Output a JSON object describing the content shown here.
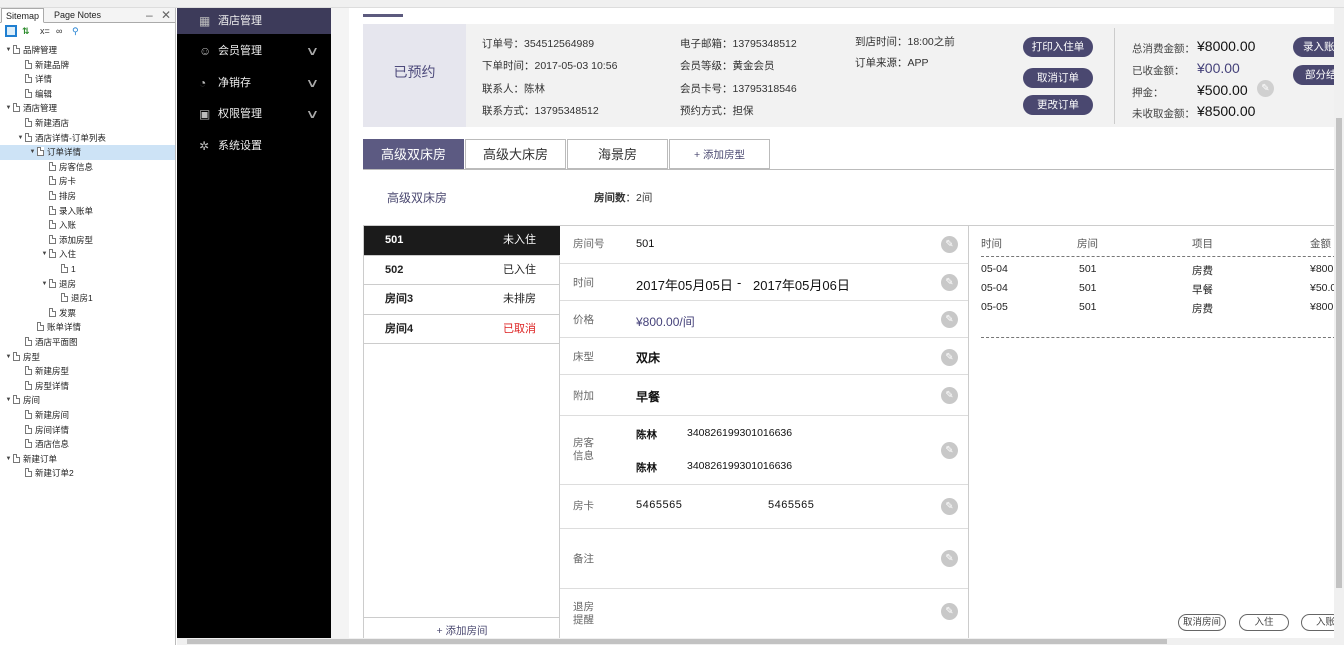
{
  "sitemap": {
    "tabs": [
      "Sitemap",
      "Page Notes"
    ],
    "tools": {
      "add_folder": "",
      "x_eq": "x=",
      "link": "∞"
    },
    "tree": [
      {
        "label": "品牌管理",
        "level": 0,
        "toggle": "▼"
      },
      {
        "label": "新建品牌",
        "level": 1,
        "toggle": ""
      },
      {
        "label": "详情",
        "level": 1,
        "toggle": ""
      },
      {
        "label": "编辑",
        "level": 1,
        "toggle": ""
      },
      {
        "label": "酒店管理",
        "level": 0,
        "toggle": "▼"
      },
      {
        "label": "新建酒店",
        "level": 1,
        "toggle": ""
      },
      {
        "label": "酒店详情-订单列表",
        "level": 1,
        "toggle": "▼"
      },
      {
        "label": "订单详情",
        "level": 2,
        "toggle": "▼",
        "selected": true
      },
      {
        "label": "房客信息",
        "level": 3,
        "toggle": ""
      },
      {
        "label": "房卡",
        "level": 3,
        "toggle": ""
      },
      {
        "label": "排房",
        "level": 3,
        "toggle": ""
      },
      {
        "label": "录入账单",
        "level": 3,
        "toggle": ""
      },
      {
        "label": "入账",
        "level": 3,
        "toggle": ""
      },
      {
        "label": "添加房型",
        "level": 3,
        "toggle": ""
      },
      {
        "label": "入住",
        "level": 3,
        "toggle": "▼"
      },
      {
        "label": "1",
        "level": 4,
        "toggle": ""
      },
      {
        "label": "退房",
        "level": 3,
        "toggle": "▼"
      },
      {
        "label": "退房1",
        "level": 4,
        "toggle": ""
      },
      {
        "label": "发票",
        "level": 3,
        "toggle": ""
      },
      {
        "label": "账单详情",
        "level": 2,
        "toggle": ""
      },
      {
        "label": "酒店平面图",
        "level": 1,
        "toggle": ""
      },
      {
        "label": "房型",
        "level": 0,
        "toggle": "▼"
      },
      {
        "label": "新建房型",
        "level": 1,
        "toggle": ""
      },
      {
        "label": "房型详情",
        "level": 1,
        "toggle": ""
      },
      {
        "label": "房间",
        "level": 0,
        "toggle": "▼"
      },
      {
        "label": "新建房间",
        "level": 1,
        "toggle": ""
      },
      {
        "label": "房间详情",
        "level": 1,
        "toggle": ""
      },
      {
        "label": "酒店信息",
        "level": 1,
        "toggle": ""
      },
      {
        "label": "新建订单",
        "level": 0,
        "toggle": "▼"
      },
      {
        "label": "新建订单2",
        "level": 1,
        "toggle": ""
      }
    ]
  },
  "nav": {
    "items": [
      {
        "label": "酒店管理",
        "icon": "hotel-icon",
        "glyph": "▦",
        "active": true,
        "expandable": false
      },
      {
        "label": "会员管理",
        "icon": "member-icon",
        "glyph": "☺",
        "active": false,
        "expandable": true
      },
      {
        "label": "净销存",
        "icon": "pie-icon",
        "glyph": "◔",
        "active": false,
        "expandable": true
      },
      {
        "label": "权限管理",
        "icon": "lock-icon",
        "glyph": "▣",
        "active": false,
        "expandable": true
      },
      {
        "label": "系统设置",
        "icon": "gear-icon",
        "glyph": "✲",
        "active": false,
        "expandable": false
      }
    ]
  },
  "order": {
    "status": "已预约",
    "fields": {
      "order_no": {
        "k": "订单号：",
        "v": "354512564989"
      },
      "order_time": {
        "k": "下单时间：",
        "v": "2017-05-03  10:56"
      },
      "contact": {
        "k": "联系人：",
        "v": "陈林"
      },
      "phone": {
        "k": "联系方式：",
        "v": "13795348512"
      },
      "email": {
        "k": "电子邮箱：",
        "v": "13795348512"
      },
      "member_level": {
        "k": "会员等级：",
        "v": "黄金会员"
      },
      "member_card": {
        "k": "会员卡号：",
        "v": "13795318546"
      },
      "booking_method": {
        "k": "预约方式：",
        "v": "担保"
      },
      "arrive_time": {
        "k": "到店时间：",
        "v": "18:00之前"
      },
      "source": {
        "k": "订单来源：",
        "v": "APP"
      }
    },
    "buttons": {
      "print": "打印入住单",
      "cancel": "取消订单",
      "change": "更改订单",
      "record": "录入账",
      "partial": "部分结"
    },
    "amounts": {
      "total": {
        "k": "总消费金额：",
        "v": "¥8000.00"
      },
      "received": {
        "k": "已收金额：",
        "v": "¥00.00"
      },
      "deposit": {
        "k": "押金：",
        "v": "¥500.00"
      },
      "unreceived": {
        "k": "未收取金额：",
        "v": "¥8500.00"
      }
    }
  },
  "room_tabs": [
    "高级双床房",
    "高级大床房",
    "海景房",
    "+ 添加房型"
  ],
  "room_type": {
    "title": "高级双床房",
    "count_k": "房间数",
    "count_v": "：2间"
  },
  "rooms": [
    {
      "no": "501",
      "status": "未入住",
      "active": true,
      "cancel": false
    },
    {
      "no": "502",
      "status": "已入住",
      "active": false,
      "cancel": false
    },
    {
      "no": "房间3",
      "status": "未排房",
      "active": false,
      "cancel": false
    },
    {
      "no": "房间4",
      "status": "已取消",
      "active": false,
      "cancel": true
    }
  ],
  "add_room": "+ 添加房间",
  "detail": {
    "room_no": {
      "k": "房间号",
      "v": "501"
    },
    "time": {
      "k": "时间",
      "from": "2017年05月05日",
      "sep": "-",
      "to": "2017年05月06日"
    },
    "price": {
      "k": "价格",
      "v": "¥800.00/间"
    },
    "bed": {
      "k": "床型",
      "v": "双床"
    },
    "extra": {
      "k": "附加",
      "v": "早餐"
    },
    "guests": {
      "k": "房客\n信息",
      "list": [
        {
          "name": "陈林",
          "id": "340826199301016636"
        },
        {
          "name": "陈林",
          "id": "340826199301016636"
        }
      ]
    },
    "card": {
      "k": "房卡",
      "v1": "5465565",
      "v2": "5465565"
    },
    "remark": {
      "k": "备注"
    },
    "checkout_reminder": {
      "k": "退房\n提醒"
    }
  },
  "ledger": {
    "headers": [
      "时间",
      "房间",
      "项目",
      "金额"
    ],
    "rows": [
      {
        "date": "05-04",
        "room": "501",
        "item": "房费",
        "amount": "¥800."
      },
      {
        "date": "05-04",
        "room": "501",
        "item": "早餐",
        "amount": "¥50.0"
      },
      {
        "date": "05-05",
        "room": "501",
        "item": "房费",
        "amount": "¥800."
      }
    ],
    "actions": [
      "取消房间",
      "入住",
      "入账"
    ]
  }
}
